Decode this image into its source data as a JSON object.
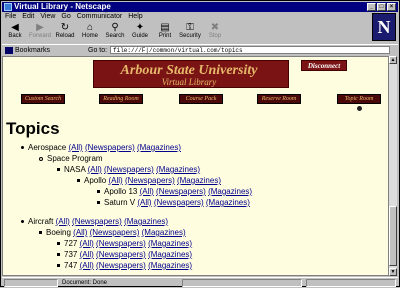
{
  "window": {
    "title": "Virtual Library - Netscape"
  },
  "menu": [
    "File",
    "Edit",
    "View",
    "Go",
    "Communicator",
    "Help"
  ],
  "toolbar": [
    {
      "label": "Back",
      "icon": "back-arrow-icon",
      "enabled": true
    },
    {
      "label": "Forward",
      "icon": "forward-arrow-icon",
      "enabled": false
    },
    {
      "label": "Reload",
      "icon": "reload-icon",
      "enabled": true
    },
    {
      "label": "Home",
      "icon": "home-icon",
      "enabled": true
    },
    {
      "label": "Search",
      "icon": "search-icon",
      "enabled": true
    },
    {
      "label": "Guide",
      "icon": "guide-icon",
      "enabled": true
    },
    {
      "label": "Print",
      "icon": "print-icon",
      "enabled": true
    },
    {
      "label": "Security",
      "icon": "security-icon",
      "enabled": true
    },
    {
      "label": "Stop",
      "icon": "stop-icon",
      "enabled": false
    }
  ],
  "location": {
    "bookmarks_label": "Bookmarks",
    "goto_label": "Go to:",
    "url": "file:///F|/common/virtual.com/topics"
  },
  "brand": {
    "logo_letter": "N"
  },
  "banner": {
    "title": "Arbour State University",
    "subtitle": "Virtual Library",
    "disconnect": "Disconnect"
  },
  "nav": [
    "Custom Search",
    "Reading Room",
    "Course Pack",
    "Reserve Room",
    "Topic Room"
  ],
  "page": {
    "heading": "Topics"
  },
  "topics": [
    {
      "level": 0,
      "name": "Aerospace",
      "links": [
        "(All)",
        "(Newspapers)",
        "(Magazines)"
      ],
      "bullet": "circle"
    },
    {
      "level": 1,
      "name": "Space Program",
      "links": [],
      "bullet": "ring"
    },
    {
      "level": 2,
      "name": "NASA",
      "links": [
        "(All)",
        "(Newspapers)",
        "(Magazines)"
      ],
      "bullet": "square"
    },
    {
      "level": 3,
      "name": "Apollo",
      "links": [
        "(All)",
        "(Newspapers)",
        "(Magazines)"
      ],
      "bullet": "square"
    },
    {
      "level": 4,
      "name": "Apollo 13",
      "links": [
        "(All)",
        "(Newspapers)",
        "(Magazines)"
      ],
      "bullet": "square"
    },
    {
      "level": 4,
      "name": "Saturn V",
      "links": [
        "(All)",
        "(Newspapers)",
        "(Magazines)"
      ],
      "bullet": "square"
    },
    {
      "level": 0,
      "name": "Aircraft",
      "links": [
        "(All)",
        "(Newspapers)",
        "(Magazines)"
      ],
      "bullet": "circle"
    },
    {
      "level": 1,
      "name": "Boeing",
      "links": [
        "(All)",
        "(Newspapers)",
        "(Magazines)"
      ],
      "bullet": "square"
    },
    {
      "level": 2,
      "name": "727",
      "links": [
        "(All)",
        "(Newspapers)",
        "(Magazines)"
      ],
      "bullet": "square"
    },
    {
      "level": 2,
      "name": "737",
      "links": [
        "(All)",
        "(Newspapers)",
        "(Magazines)"
      ],
      "bullet": "square"
    },
    {
      "level": 2,
      "name": "747",
      "links": [
        "(All)",
        "(Newspapers)",
        "(Magazines)"
      ],
      "bullet": "square"
    }
  ],
  "status": {
    "text": "Document: Done"
  },
  "colors": {
    "title_bg": "#000080",
    "page_bg": "#fffde0",
    "banner_bg": "#7a1414",
    "banner_text": "#e7b96a",
    "link": "#00008b"
  }
}
